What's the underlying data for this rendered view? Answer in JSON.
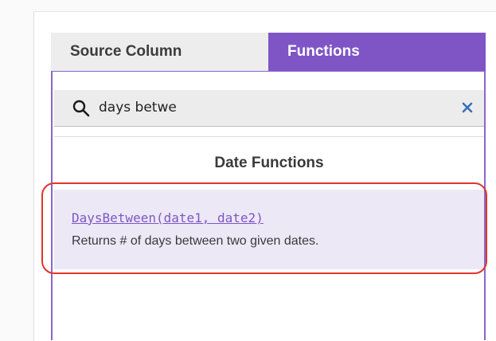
{
  "tabs": {
    "source_column": "Source Column",
    "functions": "Functions"
  },
  "search": {
    "value": "days betwe",
    "icon": "search-icon",
    "clear_icon": "close-icon"
  },
  "section": {
    "title": "Date Functions"
  },
  "result": {
    "name": "DaysBetween(date1, date2)",
    "description": "Returns # of days between two given dates."
  },
  "colors": {
    "accent": "#7f55c6",
    "highlight_outline": "#e0352b",
    "result_background": "#ece8f6",
    "tab_inactive": "#ededed"
  }
}
